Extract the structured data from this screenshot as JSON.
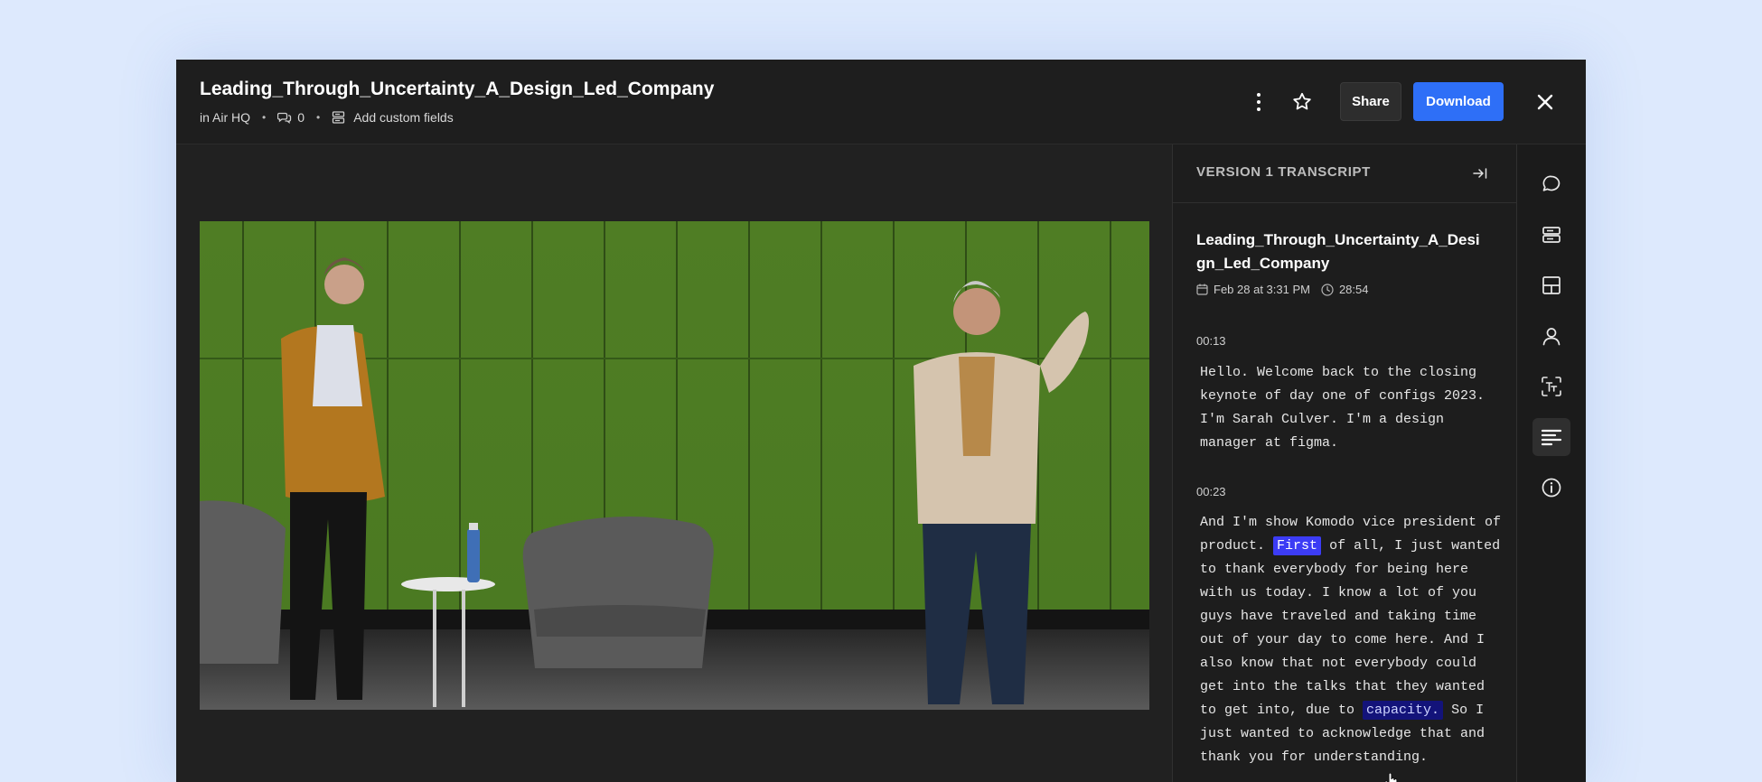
{
  "header": {
    "title": "Leading_Through_Uncertainty_A_Design_Led_Company",
    "location": "in Air HQ",
    "comment_count": "0",
    "custom_fields_label": "Add custom fields",
    "share_label": "Share",
    "download_label": "Download"
  },
  "transcript": {
    "panel_title": "VERSION 1 TRANSCRIPT",
    "file_name": "Leading_Through_Uncertainty_A_Design_Led_Company",
    "date": "Feb 28 at 3:31 PM",
    "duration": "28:54",
    "segments": [
      {
        "time": "00:13",
        "text": "Hello. Welcome back to the closing keynote of day one of configs 2023. I'm Sarah Culver. I'm a design manager at figma."
      },
      {
        "time": "00:23",
        "text_before": "And I'm show Komodo vice president of product.",
        "highlight_first": "First",
        "text_middle": "of all, I just wanted to thank everybody for being here with us today. I know a lot of you guys have traveled and taking time out of your day to come here. And I also know that not everybody could get into the talks that they wanted to get into, due to",
        "highlight_second": "capacity.",
        "text_after": "So I just wanted to acknowledge that and thank you for understanding."
      }
    ]
  },
  "colors": {
    "accent": "#2e6ff7",
    "highlight_active": "#3c3cf5",
    "highlight_hover": "#13137a"
  },
  "icons": {
    "more": "more-vertical-icon",
    "favorite": "star-icon",
    "close": "close-icon",
    "comments": "comment-icon",
    "fields": "custom-fields-icon",
    "layout": "layout-icon",
    "people": "person-icon",
    "text": "text-recognition-icon",
    "transcript": "transcript-icon",
    "info": "info-icon"
  }
}
